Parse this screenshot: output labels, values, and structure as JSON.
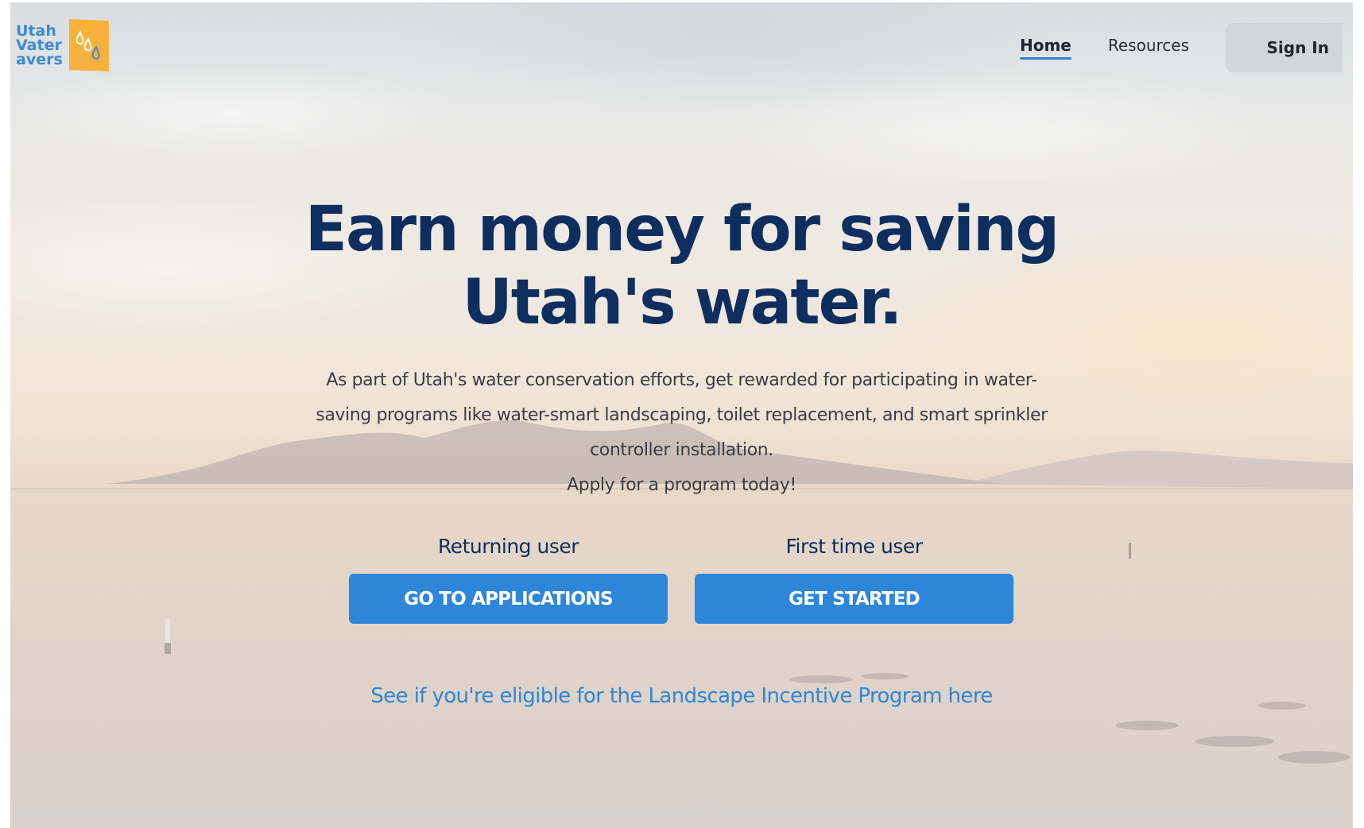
{
  "logo": {
    "lines": [
      "Utah",
      "Vater",
      "avers"
    ],
    "icon": "water-drops-icon",
    "badge_color": "#f6b23c",
    "text_color": "#3b8ad8"
  },
  "nav": {
    "items": [
      {
        "label": "Home",
        "active": true
      },
      {
        "label": "Resources",
        "active": false
      }
    ],
    "signin_label": "Sign In"
  },
  "hero": {
    "title_line1": "Earn money for saving",
    "title_line2": "Utah's water.",
    "description": "As part of Utah's water conservation efforts, get rewarded for participating in water-saving programs like water-smart landscaping, toilet replacement, and smart sprinkler controller installation.",
    "cta_text": "Apply for a program today!"
  },
  "actions": {
    "returning": {
      "label": "Returning user",
      "button": "GO TO APPLICATIONS"
    },
    "first_time": {
      "label": "First time user",
      "button": "GET STARTED"
    }
  },
  "eligibility_link": "See if you're eligible for the Landscape Incentive Program here",
  "colors": {
    "primary": "#2e86d8",
    "heading": "#0d2e5e",
    "logo_badge": "#f6b23c"
  }
}
